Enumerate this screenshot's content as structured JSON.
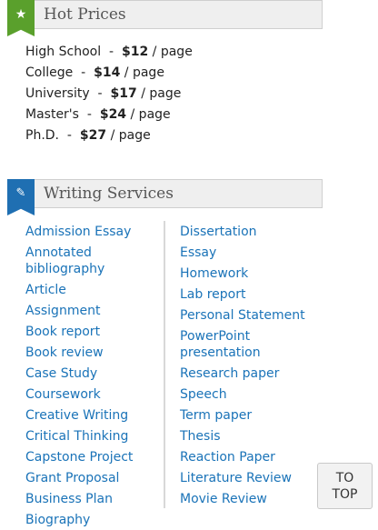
{
  "hot_prices": {
    "icon": "star-icon",
    "title": "Hot Prices",
    "items": [
      {
        "level": "High School",
        "sep": "-",
        "price": "$12",
        "unit": "/ page"
      },
      {
        "level": "College",
        "sep": "-",
        "price": "$14",
        "unit": "/ page"
      },
      {
        "level": "University",
        "sep": "-",
        "price": "$17",
        "unit": "/ page"
      },
      {
        "level": "Master's",
        "sep": "-",
        "price": "$24",
        "unit": "/ page"
      },
      {
        "level": "Ph.D.",
        "sep": "-",
        "price": "$27",
        "unit": "/ page"
      }
    ]
  },
  "writing_services": {
    "icon": "edit-icon",
    "title": "Writing Services",
    "left": [
      "Admission Essay",
      "Annotated bibliography",
      "Article",
      "Assignment",
      "Book report",
      "Book review",
      "Case Study",
      "Coursework",
      "Creative Writing",
      "Critical Thinking",
      "Capstone Project",
      "Grant Proposal",
      "Business Plan",
      "Biography"
    ],
    "right": [
      "Dissertation",
      "Essay",
      "Homework",
      "Lab report",
      "Personal Statement",
      "PowerPoint presentation",
      "Research paper",
      "Speech",
      "Term paper",
      "Thesis",
      "Reaction Paper",
      "Literature Review",
      "Movie Review"
    ]
  },
  "to_top": {
    "line1": "TO",
    "line2": "TOP"
  },
  "colors": {
    "green_badge": "#5aa02c",
    "blue_badge": "#1f6fb2",
    "link": "#1a73b8"
  }
}
